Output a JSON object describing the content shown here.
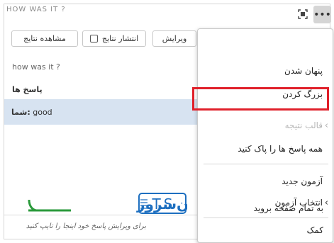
{
  "panel": {
    "title": "HOW WAS IT ?",
    "toolbar": {
      "view_results": "مشاهده نتایج",
      "publish_results": "انتشار نتایج",
      "edit": "ویرایش"
    },
    "question": "how was it ?",
    "answers_title": "پاسخ ها",
    "answer": {
      "who": "شما:",
      "text": "good"
    },
    "input_placeholder": "برای ویرایش پاسخ خود اینجا را تایپ کنید",
    "logo": {
      "text": "T.S",
      "brand": "تهران‌سرور",
      "brand_color": "#1d6fc0",
      "accent_color": "#2a9a3b"
    }
  },
  "menu": {
    "items": [
      {
        "label": "پنهان شدن",
        "disabled": false
      },
      {
        "label": "بزرگ کردن",
        "disabled": false
      },
      {
        "label": "قالب نتیجه",
        "disabled": true,
        "submenu": true
      },
      {
        "label": "همه پاسخ ها را پاک کنید",
        "disabled": false
      },
      {
        "label": "آزمون جدید",
        "disabled": false
      },
      {
        "label": "انتخاب آزمون",
        "disabled": false,
        "submenu": true
      },
      {
        "label": "به تمام صفحه بروید",
        "disabled": false
      },
      {
        "label": "کمک",
        "disabled": false
      }
    ]
  },
  "colors": {
    "highlight": "#e0202a",
    "answer_bg": "#d7e3f1"
  },
  "icons": {
    "more": "more-dots-icon",
    "focus": "focus-frame-icon",
    "chevron": "chevron-right-icon"
  }
}
